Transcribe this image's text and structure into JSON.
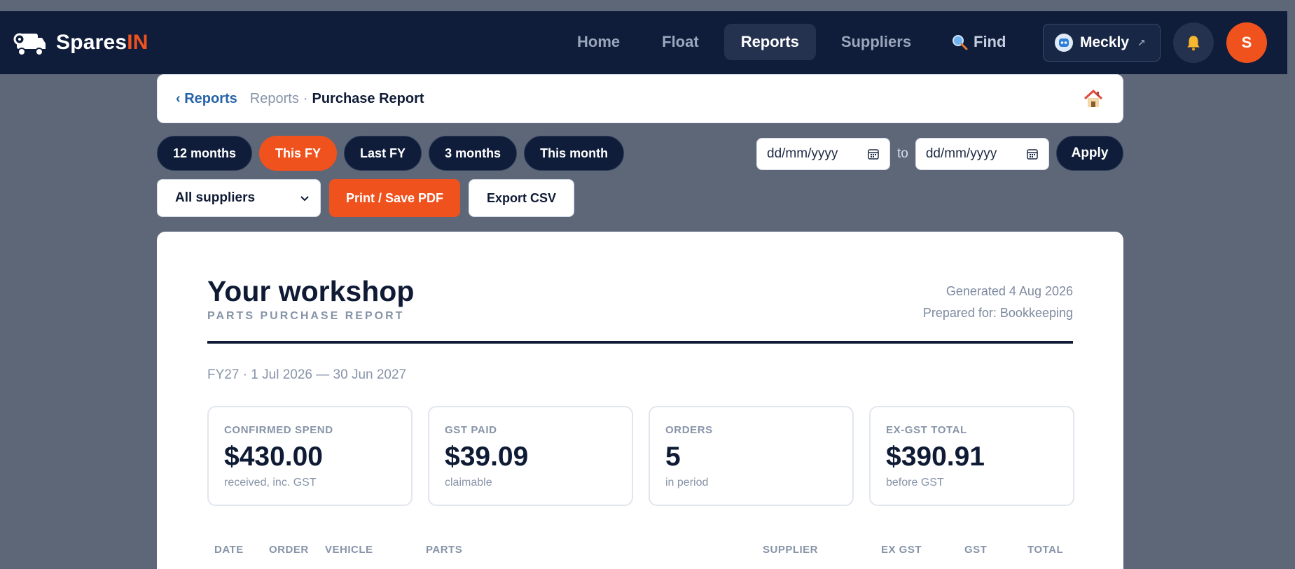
{
  "nav": {
    "brand_main": "Spares",
    "brand_accent": "IN",
    "links": [
      {
        "label": "Home",
        "active": false
      },
      {
        "label": "Float",
        "active": false
      },
      {
        "label": "Reports",
        "active": true
      },
      {
        "label": "Suppliers",
        "active": false
      }
    ],
    "find_label": "Find",
    "user_label": "Meckly",
    "user_arrow": "↗",
    "profile_initial": "S"
  },
  "breadcrumb": {
    "back_label": "‹ Reports",
    "parent": "Reports",
    "separator": "·",
    "current": "Purchase Report"
  },
  "filters": {
    "pills": [
      {
        "label": "12 months",
        "active": false
      },
      {
        "label": "This FY",
        "active": true
      },
      {
        "label": "Last FY",
        "active": false
      },
      {
        "label": "3 months",
        "active": false
      },
      {
        "label": "This month",
        "active": false
      }
    ],
    "date_from_placeholder": "dd/mm/yyyy",
    "date_to_label": "to",
    "date_to_placeholder": "dd/mm/yyyy",
    "apply_label": "Apply",
    "supplier_select": "All suppliers",
    "print_label": "Print / Save PDF",
    "export_label": "Export CSV"
  },
  "report": {
    "title": "Your workshop",
    "subtitle": "PARTS PURCHASE REPORT",
    "generated": "Generated 4 Aug 2026",
    "prepared_for": "Prepared for: Bookkeeping",
    "period": "FY27 · 1 Jul 2026 — 30 Jun 2027",
    "stats": [
      {
        "label": "CONFIRMED SPEND",
        "value": "$430.00",
        "note": "received, inc. GST"
      },
      {
        "label": "GST PAID",
        "value": "$39.09",
        "note": "claimable"
      },
      {
        "label": "ORDERS",
        "value": "5",
        "note": "in period"
      },
      {
        "label": "EX-GST TOTAL",
        "value": "$390.91",
        "note": "before GST"
      }
    ],
    "columns": [
      "DATE",
      "ORDER",
      "VEHICLE",
      "PARTS",
      "SUPPLIER",
      "EX GST",
      "GST",
      "TOTAL"
    ]
  },
  "colors": {
    "navy": "#0f1d3a",
    "accent": "#f0521e",
    "muted": "#8794a8",
    "link": "#2563a8"
  },
  "icons": {
    "brand": "van-gear-icon",
    "find": "magnifier-icon",
    "user": "robot-avatar-icon",
    "bell": "bell-icon",
    "home": "house-icon",
    "calendar": "calendar-icon",
    "select": "chevron-down-icon"
  }
}
